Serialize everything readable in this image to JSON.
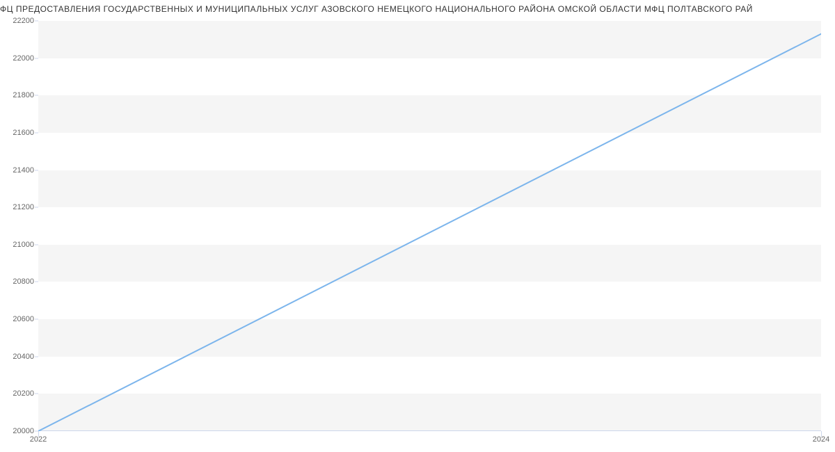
{
  "title": "ФЦ ПРЕДОСТАВЛЕНИЯ  ГОСУДАРСТВЕННЫХ  И  МУНИЦИПАЛЬНЫХ УСЛУГ АЗОВСКОГО НЕМЕЦКОГО НАЦИОНАЛЬНОГО РАЙОНА ОМСКОЙ ОБЛАСТИ МФЦ ПОЛТАВСКОГО РАЙ",
  "chart_data": {
    "type": "line",
    "x": [
      2022,
      2024
    ],
    "y": [
      20000,
      22130
    ],
    "xlabel": "",
    "ylabel": "",
    "xticks": [
      2022,
      2024
    ],
    "yticks": [
      20000,
      20200,
      20400,
      20600,
      20800,
      21000,
      21200,
      21400,
      21600,
      21800,
      22000,
      22200
    ],
    "xlim": [
      2022,
      2024
    ],
    "ylim": [
      20000,
      22200
    ],
    "grid_bands": true,
    "series_name": "",
    "colors": {
      "line": "#7cb5ec",
      "band": "#f5f5f5",
      "axis": "#ccd6eb"
    }
  }
}
